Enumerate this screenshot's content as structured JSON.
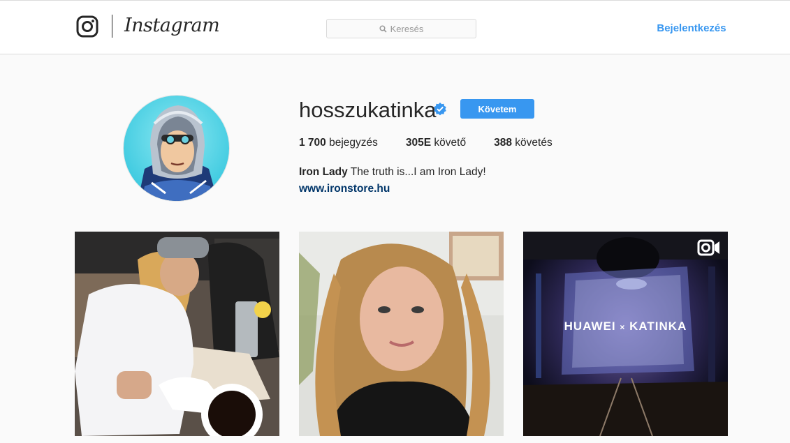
{
  "header": {
    "logo_text": "Instagram",
    "search_placeholder": "Keresés",
    "login_label": "Bejelentkezés"
  },
  "profile": {
    "username": "hosszukatinka",
    "verified": true,
    "follow_label": "Követem",
    "stats": [
      {
        "value": "1 700",
        "label": "bejegyzés"
      },
      {
        "value": "305E",
        "label": "követő"
      },
      {
        "value": "388",
        "label": "követés"
      }
    ],
    "bio_name": "Iron Lady",
    "bio_text": "The truth is...I am Iron Lady!",
    "website": "www.ironstore.hu"
  },
  "posts": [
    {
      "type": "image"
    },
    {
      "type": "image"
    },
    {
      "type": "video",
      "overlay_left": "HUAWEI",
      "overlay_sep": "×",
      "overlay_right": "KATINKA"
    }
  ],
  "colors": {
    "accent": "#3897f0",
    "link": "#003569",
    "background": "#fafafa"
  }
}
